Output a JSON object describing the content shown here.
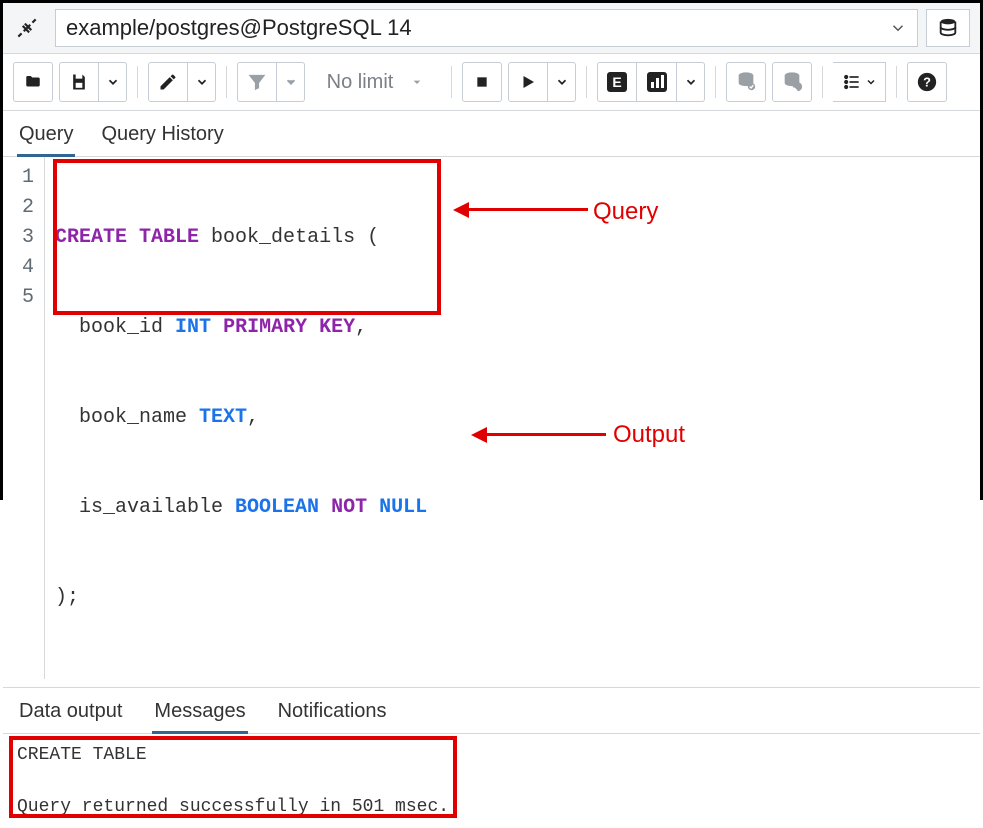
{
  "connection": {
    "label": "example/postgres@PostgreSQL 14"
  },
  "toolbar": {
    "limit_label": "No limit"
  },
  "code_tabs": {
    "query": "Query",
    "history": "Query History"
  },
  "editor": {
    "lines": [
      "1",
      "2",
      "3",
      "4",
      "5"
    ],
    "line1_a": "CREATE",
    "line1_b": "TABLE",
    "line1_c": " book_details (",
    "line2_a": "  book_id ",
    "line2_b": "INT",
    "line2_c": "PRIMARY",
    "line2_d": "KEY",
    "line2_e": ",",
    "line3_a": "  book_name ",
    "line3_b": "TEXT",
    "line3_c": ",",
    "line4_a": "  is_available ",
    "line4_b": "BOOLEAN",
    "line4_c": "NOT",
    "line4_d": "NULL",
    "line5": ");"
  },
  "out_tabs": {
    "data": "Data output",
    "msg": "Messages",
    "notif": "Notifications"
  },
  "output": {
    "line1": "CREATE TABLE",
    "line2": "",
    "line3": "Query returned successfully in 501 msec."
  },
  "annotations": {
    "query": "Query",
    "output": "Output"
  }
}
